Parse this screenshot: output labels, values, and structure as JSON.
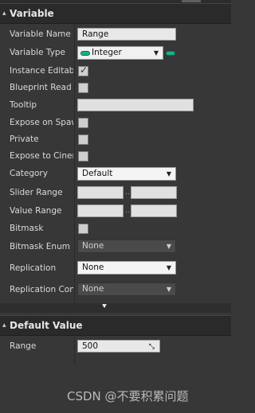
{
  "sections": {
    "variable": {
      "title": "Variable"
    },
    "default_value": {
      "title": "Default Value"
    }
  },
  "rows": {
    "variable_name": {
      "label": "Variable Name",
      "value": "Range"
    },
    "variable_type": {
      "label": "Variable Type",
      "value": "Integer",
      "pin_color": "#17b08a"
    },
    "instance_editable": {
      "label": "Instance Editable",
      "checked": true
    },
    "blueprint_read_only": {
      "label": "Blueprint Read Only",
      "checked": false
    },
    "tooltip": {
      "label": "Tooltip",
      "value": ""
    },
    "expose_on_spawn": {
      "label": "Expose on Spawn",
      "checked": false
    },
    "private": {
      "label": "Private",
      "checked": false
    },
    "expose_to_cinematics": {
      "label": "Expose to Cinematics",
      "checked": false
    },
    "category": {
      "label": "Category",
      "value": "Default"
    },
    "slider_range": {
      "label": "Slider Range",
      "min": "",
      "max": ""
    },
    "value_range": {
      "label": "Value Range",
      "min": "",
      "max": ""
    },
    "bitmask": {
      "label": "Bitmask",
      "checked": false
    },
    "bitmask_enum": {
      "label": "Bitmask Enum",
      "value": "None"
    },
    "replication": {
      "label": "Replication",
      "value": "None"
    },
    "replication_condition": {
      "label": "Replication Condition",
      "value": "None"
    },
    "range_default": {
      "label": "Range",
      "value": "500"
    }
  },
  "icons": {
    "section_collapse": "▴",
    "expand_advanced": "chevron-down-icon",
    "dropdown_arrow": "▼"
  },
  "watermark": "CSDN @不要积累问题"
}
